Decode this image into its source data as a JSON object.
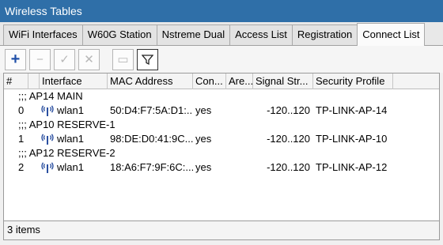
{
  "window": {
    "title": "Wireless Tables"
  },
  "tabs": [
    {
      "label": "WiFi Interfaces"
    },
    {
      "label": "W60G Station"
    },
    {
      "label": "Nstreme Dual"
    },
    {
      "label": "Access List"
    },
    {
      "label": "Registration"
    },
    {
      "label": "Connect List",
      "active": true
    }
  ],
  "toolbar": {
    "add": "+",
    "remove": "−",
    "enable": "✓",
    "disable": "✕",
    "comment": "▭",
    "filter": "▽"
  },
  "columns": [
    "#",
    "",
    "Interface",
    "MAC Address",
    "Con...",
    "Are...",
    "Signal Str...",
    "Security Profile"
  ],
  "groups": [
    {
      "comment": ";;; AP14 MAIN",
      "row": {
        "num": "0",
        "interface": "wlan1",
        "mac": "50:D4:F7:5A:D1:...",
        "connect": "yes",
        "area": "",
        "signal": "-120..120",
        "profile": "TP-LINK-AP-14"
      }
    },
    {
      "comment": ";;; AP10 RESERVE-1",
      "row": {
        "num": "1",
        "interface": "wlan1",
        "mac": "98:DE:D0:41:9C...",
        "connect": "yes",
        "area": "",
        "signal": "-120..120",
        "profile": "TP-LINK-AP-10"
      }
    },
    {
      "comment": ";;; AP12 RESERVE-2",
      "row": {
        "num": "2",
        "interface": "wlan1",
        "mac": "18:A6:F7:9F:6C:...",
        "connect": "yes",
        "area": "",
        "signal": "-120..120",
        "profile": "TP-LINK-AP-12"
      }
    }
  ],
  "status": {
    "items": "3 items"
  },
  "colors": {
    "titlebar": "#2f6fa8",
    "add_icon": "#1f4fa8",
    "wifi_icon": "#2a4fa0"
  },
  "icons": {
    "interface": "wireless-antenna-icon"
  }
}
